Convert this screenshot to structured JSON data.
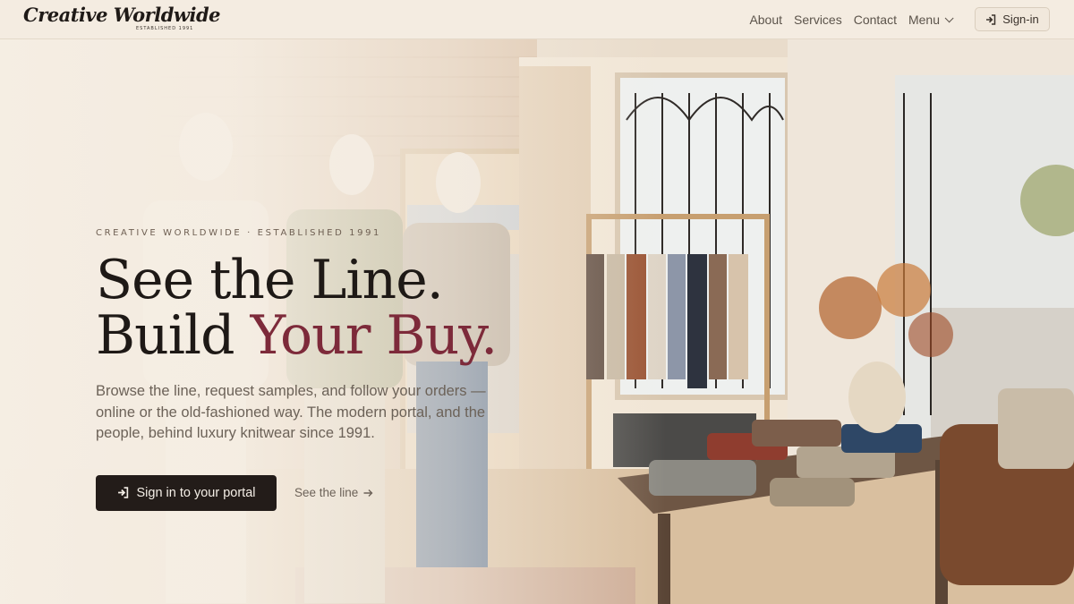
{
  "brand": {
    "logo_text": "Creative Worldwide",
    "logo_sub": "ESTABLISHED 1991"
  },
  "nav": {
    "items": [
      {
        "label": "About"
      },
      {
        "label": "Services"
      },
      {
        "label": "Contact"
      },
      {
        "label": "Menu",
        "dropdown": true
      }
    ],
    "signin_label": "Sign-in",
    "signin_icon": "sign-in-icon"
  },
  "hero": {
    "eyebrow": "CREATIVE WORLDWIDE · ESTABLISHED 1991",
    "headline_line1": "See the Line.",
    "headline_line2_prefix": "Build ",
    "headline_line2_accent": "Your Buy.",
    "subtext": "Browse the line, request samples, and follow your orders — online or the old-fashioned way. The modern portal, and the people, behind luxury knitwear since 1991.",
    "primary_cta": "Sign in to your portal",
    "secondary_cta": "See the line",
    "background_image": "boutique-interior-knitwear"
  },
  "colors": {
    "accent": "#7d2a3a",
    "dark": "#231c19",
    "cream": "#f4ece1"
  }
}
